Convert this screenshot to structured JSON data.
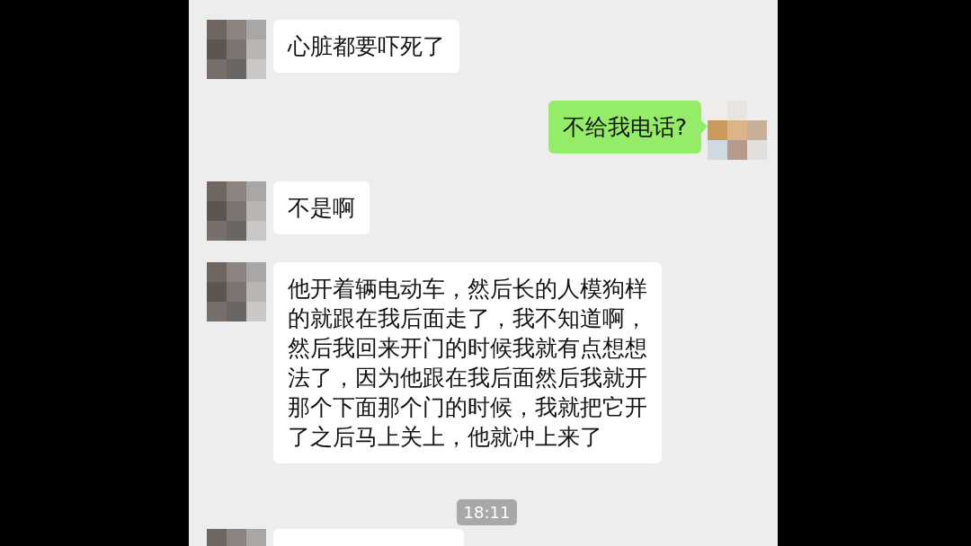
{
  "chat": {
    "messages": [
      {
        "kind": "received",
        "text": "心脏都要吓死了"
      },
      {
        "kind": "sent",
        "text": "不给我电话?"
      },
      {
        "kind": "received",
        "text": "不是啊"
      },
      {
        "kind": "received",
        "text": "他开着辆电动车，然后长的人模狗样的就跟在我后面走了，我不知道啊，然后我回来开门的时候我就有点想想法了，因为他跟在我后面然后我就开那个下面那个门的时候，我就把它开了之后马上关上，他就冲上来了"
      },
      {
        "kind": "time",
        "text": "18:11"
      },
      {
        "kind": "received"
      }
    ]
  }
}
